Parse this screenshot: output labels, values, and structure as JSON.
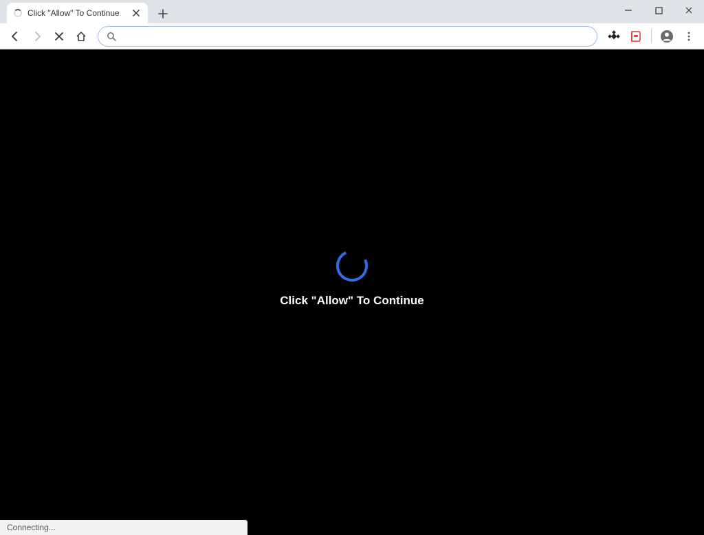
{
  "window": {
    "minimize_label": "Minimize",
    "maximize_label": "Maximize",
    "close_label": "Close"
  },
  "tab": {
    "title": "Click \"Allow\" To Continue"
  },
  "toolbar": {
    "back_label": "Back",
    "forward_label": "Forward",
    "stop_label": "Stop",
    "home_label": "Home",
    "address_value": "",
    "address_placeholder": ""
  },
  "page": {
    "message": "Click \"Allow\" To Continue"
  },
  "status": {
    "text": "Connecting..."
  }
}
